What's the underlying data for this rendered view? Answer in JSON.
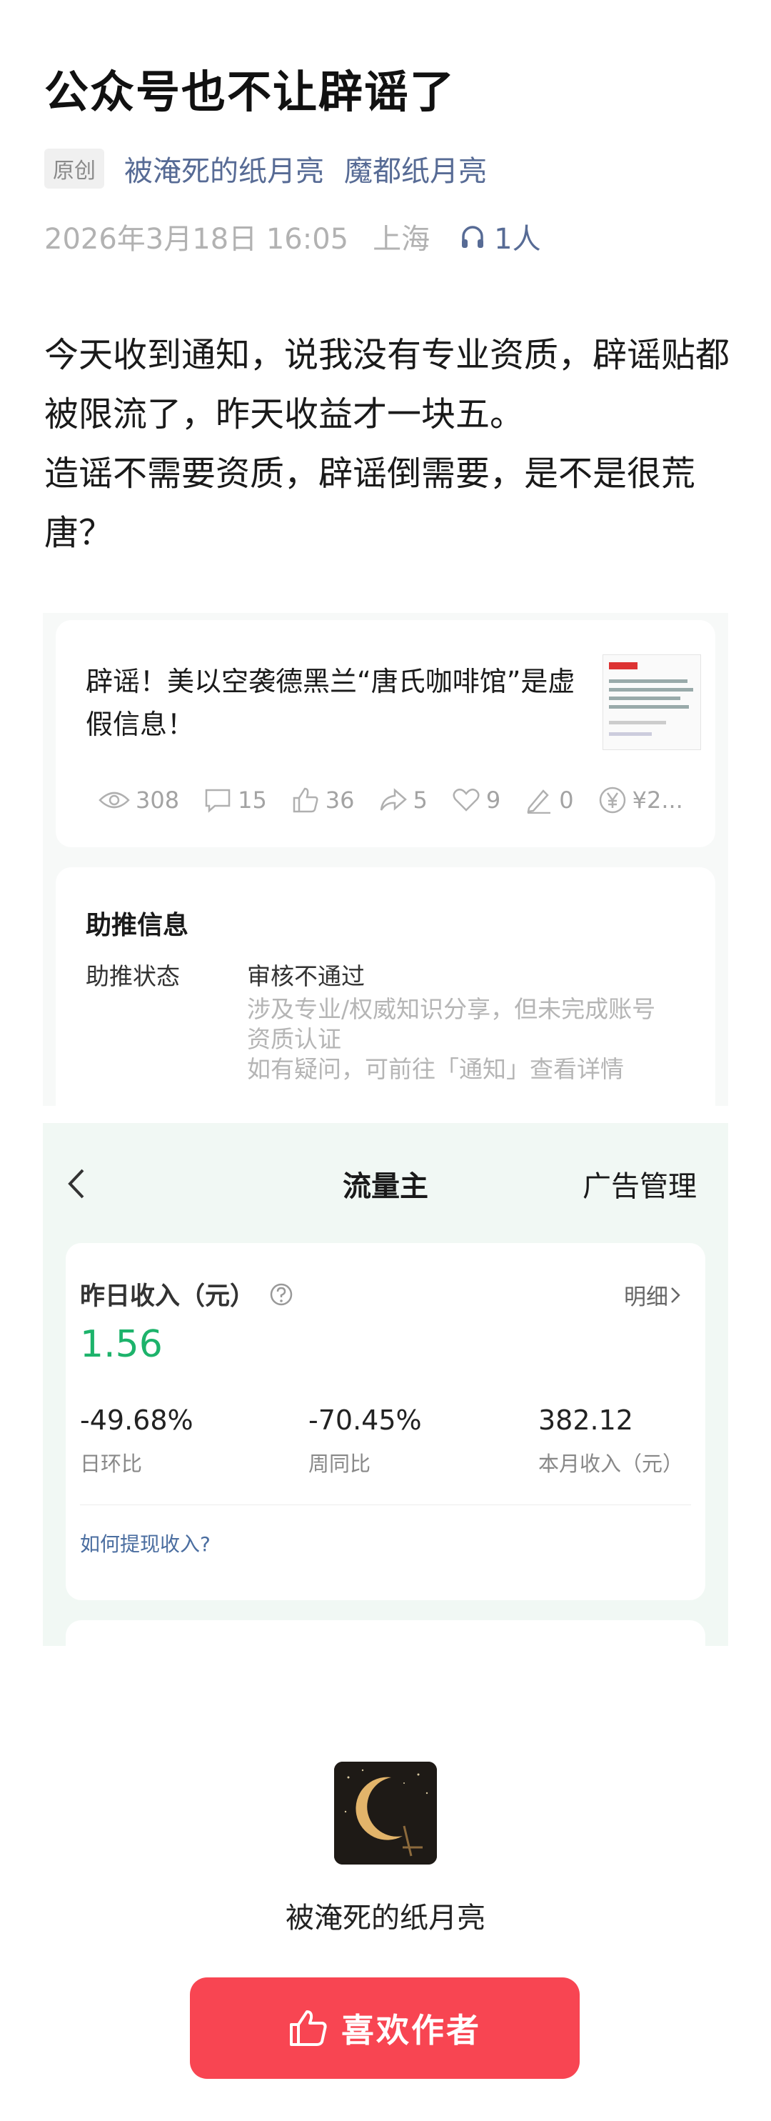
{
  "article": {
    "title": "公众号也不让辟谣了",
    "original_tag": "原创",
    "author": "被淹死的纸月亮",
    "account": "魔都纸月亮",
    "datetime": "2026年3月18日 16:05",
    "location": "上海",
    "listeners": "1人",
    "paragraphs": [
      "今天收到通知，说我没有专业资质，辟谣贴都被限流了，昨天收益才一块五。",
      "造谣不需要资质，辟谣倒需要，是不是很荒唐？"
    ]
  },
  "screenshot1": {
    "post_title": "辟谣！美以空袭德黑兰“唐氏咖啡馆”是虚假信息！",
    "stats": {
      "views": "308",
      "comments": "15",
      "likes": "36",
      "shares": "5",
      "favorites": "9",
      "edits": "0",
      "reward": "¥2..."
    },
    "boost": {
      "heading": "助推信息",
      "status_label": "助推状态",
      "status_value": "审核不通过",
      "note_line1": "涉及专业/权威知识分享，但未完成账号资质认证",
      "note_line2": "如有疑问，可前往「通知」查看详情"
    }
  },
  "screenshot2": {
    "nav_title": "流量主",
    "ad_manage": "广告管理",
    "income_heading": "昨日收入（元）",
    "detail_link": "明细",
    "income_value": "1.56",
    "metrics": [
      {
        "value": "-49.68%",
        "label": "日环比"
      },
      {
        "value": "-70.45%",
        "label": "周同比"
      },
      {
        "value": "382.12",
        "label": "本月收入（元）"
      }
    ],
    "howto_link": "如何提现收入?",
    "accent_color": "#1db36b"
  },
  "footer": {
    "author_name": "被淹死的纸月亮",
    "like_button": "喜欢作者",
    "button_color": "#f84552"
  }
}
